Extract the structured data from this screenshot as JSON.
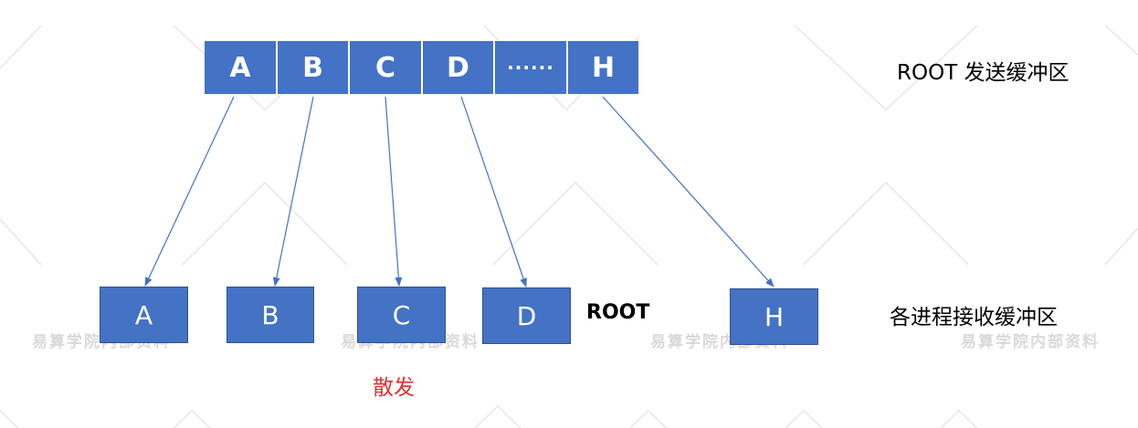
{
  "send_buffer": {
    "label": "ROOT 发送缓冲区",
    "cells": [
      "A",
      "B",
      "C",
      "D",
      "······",
      "H"
    ]
  },
  "receive_buffers": {
    "label": "各进程接收缓冲区",
    "cells": [
      "A",
      "B",
      "C",
      "D",
      "H"
    ],
    "root_label": "ROOT"
  },
  "operation_label": "散发",
  "watermark": "易算学院内部资料",
  "colors": {
    "cell_fill": "#4472c4",
    "cell_text": "#ffffff",
    "arrow": "#4472c4",
    "operation_text": "#e03030",
    "watermark": "#d9d9d9"
  }
}
